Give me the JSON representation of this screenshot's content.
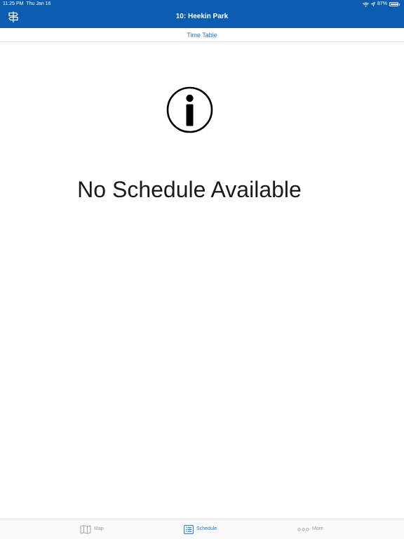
{
  "status_bar": {
    "time": "11:25 PM",
    "date": "Thu Jan 16",
    "battery": "87%",
    "battery_level": 0.87
  },
  "nav": {
    "title": "10: Heekin Park",
    "left_icon": "signpost-icon"
  },
  "segment": {
    "label": "Time Table"
  },
  "content": {
    "icon": "info-icon",
    "message": "No Schedule Available"
  },
  "tabs": [
    {
      "label": "Map",
      "icon": "map-icon",
      "active": false
    },
    {
      "label": "Schedule",
      "icon": "list-icon",
      "active": true
    },
    {
      "label": "More",
      "icon": "more-dots-icon",
      "active": false
    }
  ],
  "colors": {
    "header": "#0a5cb0",
    "accent": "#1a73d0",
    "inactive_tab": "#9a9a9a"
  }
}
